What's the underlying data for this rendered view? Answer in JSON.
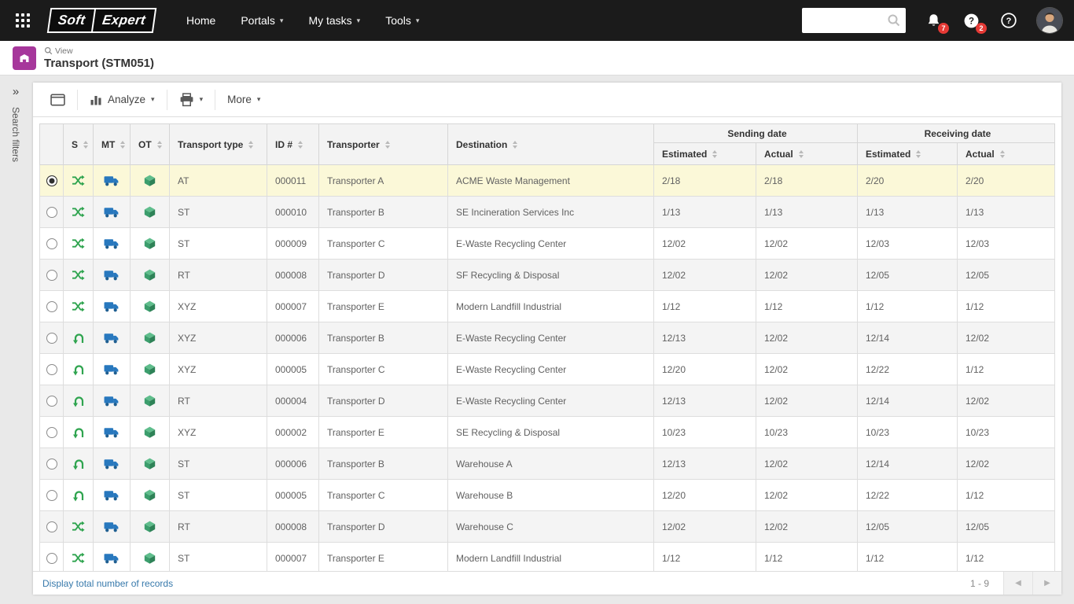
{
  "topbar": {
    "logo": {
      "part1": "Soft",
      "part2": "Expert"
    },
    "nav": [
      {
        "label": "Home",
        "dropdown": false
      },
      {
        "label": "Portals",
        "dropdown": true
      },
      {
        "label": "My tasks",
        "dropdown": true
      },
      {
        "label": "Tools",
        "dropdown": true
      }
    ],
    "search": {
      "placeholder": "",
      "value": ""
    },
    "notifications_badge": "7",
    "assistant_badge": "2"
  },
  "page_header": {
    "view_label": "View",
    "title": "Transport (STM051)"
  },
  "filters_panel": {
    "collapse_glyph": "»",
    "label": "Search filters"
  },
  "toolbar": {
    "analyze_label": "Analyze",
    "more_label": "More"
  },
  "table": {
    "columns": {
      "s": "S",
      "mt": "MT",
      "ot": "OT",
      "transport_type": "Transport type",
      "id": "ID #",
      "transporter": "Transporter",
      "destination": "Destination"
    },
    "groups": {
      "sending": "Sending date",
      "receiving": "Receiving date"
    },
    "subcolumns": {
      "estimated": "Estimated",
      "actual": "Actual"
    },
    "rows": [
      {
        "selected": true,
        "status": "transfer",
        "type": "AT",
        "id": "000011",
        "transporter": "Transporter A",
        "destination": "ACME Waste Management",
        "send_est": "2/18",
        "send_act": "2/18",
        "recv_est": "2/20",
        "recv_act": "2/20"
      },
      {
        "selected": false,
        "status": "transfer",
        "type": "ST",
        "id": "000010",
        "transporter": "Transporter B",
        "destination": "SE Incineration Services Inc",
        "send_est": "1/13",
        "send_act": "1/13",
        "recv_est": "1/13",
        "recv_act": "1/13"
      },
      {
        "selected": false,
        "status": "transfer",
        "type": "ST",
        "id": "000009",
        "transporter": "Transporter C",
        "destination": "E-Waste Recycling Center",
        "send_est": "12/02",
        "send_act": "12/02",
        "recv_est": "12/03",
        "recv_act": "12/03"
      },
      {
        "selected": false,
        "status": "transfer",
        "type": "RT",
        "id": "000008",
        "transporter": "Transporter D",
        "destination": "SF Recycling & Disposal",
        "send_est": "12/02",
        "send_act": "12/02",
        "recv_est": "12/05",
        "recv_act": "12/05"
      },
      {
        "selected": false,
        "status": "transfer",
        "type": "XYZ",
        "id": "000007",
        "transporter": "Transporter E",
        "destination": "Modern Landfill Industrial",
        "send_est": "1/12",
        "send_act": "1/12",
        "recv_est": "1/12",
        "recv_act": "1/12"
      },
      {
        "selected": false,
        "status": "return",
        "type": "XYZ",
        "id": "000006",
        "transporter": "Transporter B",
        "destination": "E-Waste Recycling Center",
        "send_est": "12/13",
        "send_act": "12/02",
        "recv_est": "12/14",
        "recv_act": "12/02"
      },
      {
        "selected": false,
        "status": "return",
        "type": "XYZ",
        "id": "000005",
        "transporter": "Transporter C",
        "destination": "E-Waste Recycling Center",
        "send_est": "12/20",
        "send_act": "12/02",
        "recv_est": "12/22",
        "recv_act": "1/12"
      },
      {
        "selected": false,
        "status": "return",
        "type": "RT",
        "id": "000004",
        "transporter": "Transporter D",
        "destination": "E-Waste Recycling Center",
        "send_est": "12/13",
        "send_act": "12/02",
        "recv_est": "12/14",
        "recv_act": "12/02"
      },
      {
        "selected": false,
        "status": "return",
        "type": "XYZ",
        "id": "000002",
        "transporter": "Transporter E",
        "destination": "SE Recycling & Disposal",
        "send_est": "10/23",
        "send_act": "10/23",
        "recv_est": "10/23",
        "recv_act": "10/23"
      },
      {
        "selected": false,
        "status": "return",
        "type": "ST",
        "id": "000006",
        "transporter": "Transporter B",
        "destination": "Warehouse A",
        "send_est": "12/13",
        "send_act": "12/02",
        "recv_est": "12/14",
        "recv_act": "12/02"
      },
      {
        "selected": false,
        "status": "return",
        "type": "ST",
        "id": "000005",
        "transporter": "Transporter C",
        "destination": "Warehouse B",
        "send_est": "12/20",
        "send_act": "12/02",
        "recv_est": "12/22",
        "recv_act": "1/12"
      },
      {
        "selected": false,
        "status": "transfer",
        "type": "RT",
        "id": "000008",
        "transporter": "Transporter D",
        "destination": "Warehouse C",
        "send_est": "12/02",
        "send_act": "12/02",
        "recv_est": "12/05",
        "recv_act": "12/05"
      },
      {
        "selected": false,
        "status": "transfer",
        "type": "ST",
        "id": "000007",
        "transporter": "Transporter E",
        "destination": "Modern Landfill Industrial",
        "send_est": "1/12",
        "send_act": "1/12",
        "recv_est": "1/12",
        "recv_act": "1/12"
      }
    ]
  },
  "footer": {
    "records_link": "Display total number of records",
    "range": "1 - 9"
  },
  "colors": {
    "topbar_bg": "#1b1b1b",
    "accent_magenta": "#a6379b",
    "status_green": "#2fa44f",
    "truck_blue": "#2878be",
    "badge_red": "#e53935",
    "link_blue": "#3779ab",
    "selected_row": "#fbf8d8"
  }
}
